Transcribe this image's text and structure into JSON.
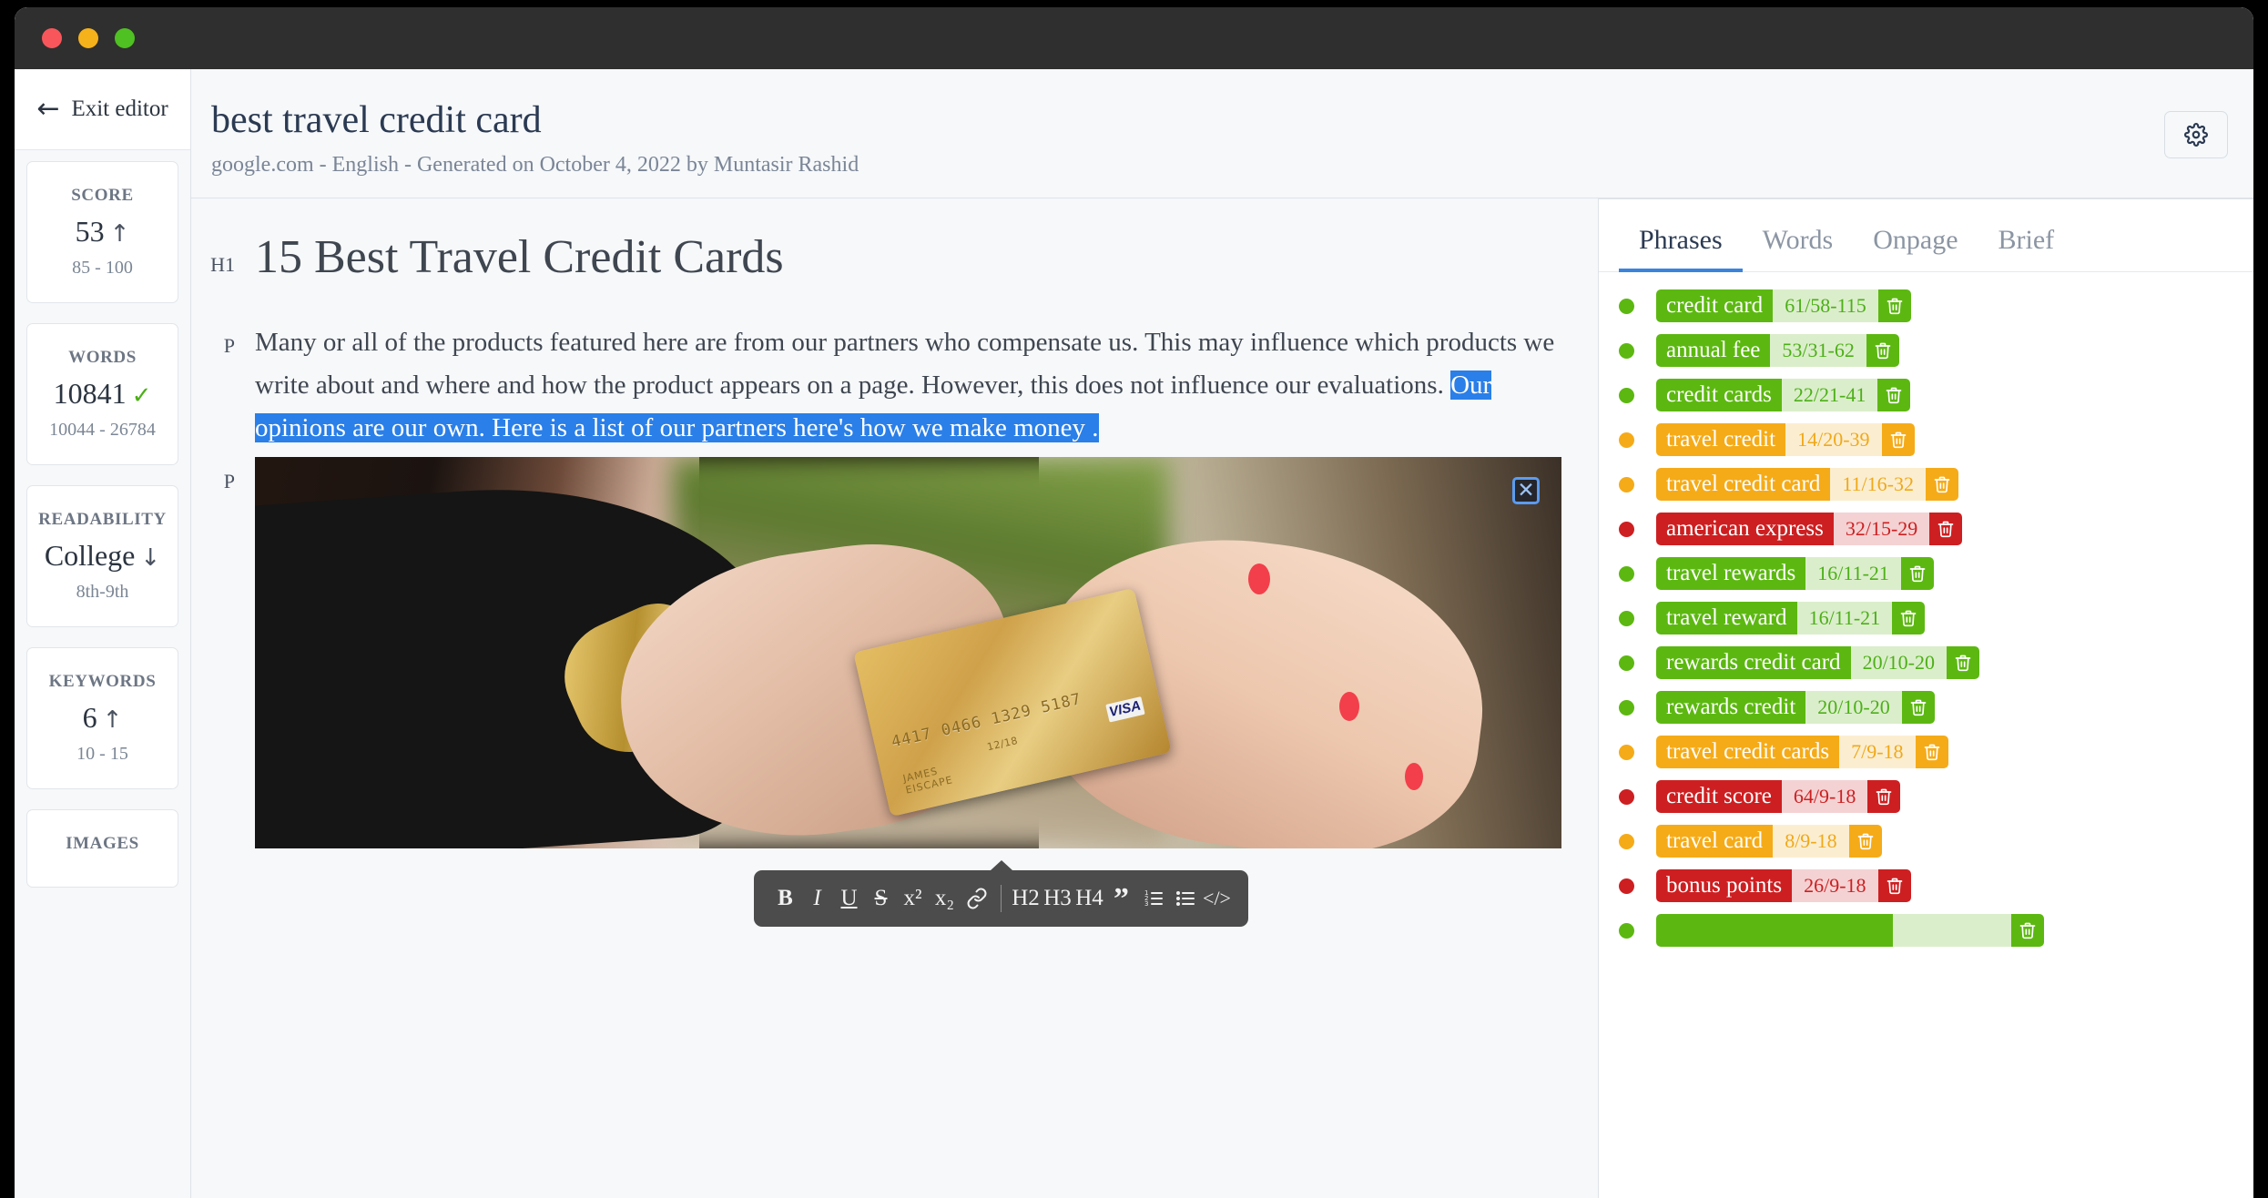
{
  "window": {
    "traffic_lights": [
      "close",
      "minimize",
      "maximize"
    ]
  },
  "sidebar": {
    "exit_label": "Exit editor",
    "exit_icon": "arrow-left-icon",
    "stats": [
      {
        "title": "SCORE",
        "value": "53",
        "indicator": "up",
        "range": "85 - 100"
      },
      {
        "title": "WORDS",
        "value": "10841",
        "indicator": "check",
        "range": "10044 - 26784"
      },
      {
        "title": "READABILITY",
        "value": "College",
        "indicator": "down",
        "range": "8th-9th"
      },
      {
        "title": "KEYWORDS",
        "value": "6",
        "indicator": "up",
        "range": "10 - 15"
      },
      {
        "title": "IMAGES",
        "value": "",
        "indicator": "",
        "range": ""
      }
    ]
  },
  "header": {
    "title": "best travel credit card",
    "meta": "google.com - English - Generated on October 4, 2022 by Muntasir Rashid",
    "settings_icon": "gear-icon"
  },
  "document": {
    "h1_tag": "H1",
    "h1_text": "15 Best Travel Credit Cards",
    "p_tag": "P",
    "paragraph_plain": "Many or all of the products featured here are from our partners who compensate us. This may influence which products we write about and where and how the product appears on a page. However, this does not influence our evaluations.",
    "paragraph_selected": "Our opinions are our own. Here is a list of our partners here's how we make money .",
    "image_tag": "P",
    "image_close_label": "✕",
    "image_card_number": "4417 0466 1329 5187",
    "image_card_name": "JAMES\nEISCAPE",
    "image_card_date": "12/18",
    "image_card_brand": "VISA"
  },
  "toolbar": {
    "buttons": [
      {
        "name": "bold",
        "label": "B"
      },
      {
        "name": "italic",
        "label": "I"
      },
      {
        "name": "underline",
        "label": "U"
      },
      {
        "name": "strikethrough",
        "label": "S"
      },
      {
        "name": "superscript",
        "label": "x²"
      },
      {
        "name": "subscript",
        "label": "x₂"
      },
      {
        "name": "link",
        "label": "🔗"
      },
      {
        "name": "heading-2",
        "label": "H2"
      },
      {
        "name": "heading-3",
        "label": "H3"
      },
      {
        "name": "heading-4",
        "label": "H4"
      },
      {
        "name": "blockquote",
        "label": "”"
      },
      {
        "name": "ordered-list",
        "label": "≔"
      },
      {
        "name": "bullet-list",
        "label": "☰"
      },
      {
        "name": "code-block",
        "label": "</>"
      }
    ]
  },
  "right_panel": {
    "tabs": [
      {
        "label": "Phrases",
        "active": true
      },
      {
        "label": "Words",
        "active": false
      },
      {
        "label": "Onpage",
        "active": false
      },
      {
        "label": "Brief",
        "active": false
      }
    ],
    "phrases": [
      {
        "term": "credit card",
        "count": "61/58-115",
        "status": "green"
      },
      {
        "term": "annual fee",
        "count": "53/31-62",
        "status": "green"
      },
      {
        "term": "credit cards",
        "count": "22/21-41",
        "status": "green"
      },
      {
        "term": "travel credit",
        "count": "14/20-39",
        "status": "orange"
      },
      {
        "term": "travel credit card",
        "count": "11/16-32",
        "status": "orange"
      },
      {
        "term": "american express",
        "count": "32/15-29",
        "status": "red"
      },
      {
        "term": "travel rewards",
        "count": "16/11-21",
        "status": "green"
      },
      {
        "term": "travel reward",
        "count": "16/11-21",
        "status": "green"
      },
      {
        "term": "rewards credit card",
        "count": "20/10-20",
        "status": "green"
      },
      {
        "term": "rewards credit",
        "count": "20/10-20",
        "status": "green"
      },
      {
        "term": "travel credit cards",
        "count": "7/9-18",
        "status": "orange"
      },
      {
        "term": "credit score",
        "count": "64/9-18",
        "status": "red"
      },
      {
        "term": "travel card",
        "count": "8/9-18",
        "status": "orange"
      },
      {
        "term": "bonus points",
        "count": "26/9-18",
        "status": "red"
      },
      {
        "term": "",
        "count": "",
        "status": "green"
      }
    ],
    "delete_icon": "trash-icon"
  },
  "colors": {
    "accent": "#3a83dd",
    "good": "#5cb811",
    "warn": "#f5ab18",
    "bad": "#cd1f21",
    "selection": "#2a7fe8"
  }
}
